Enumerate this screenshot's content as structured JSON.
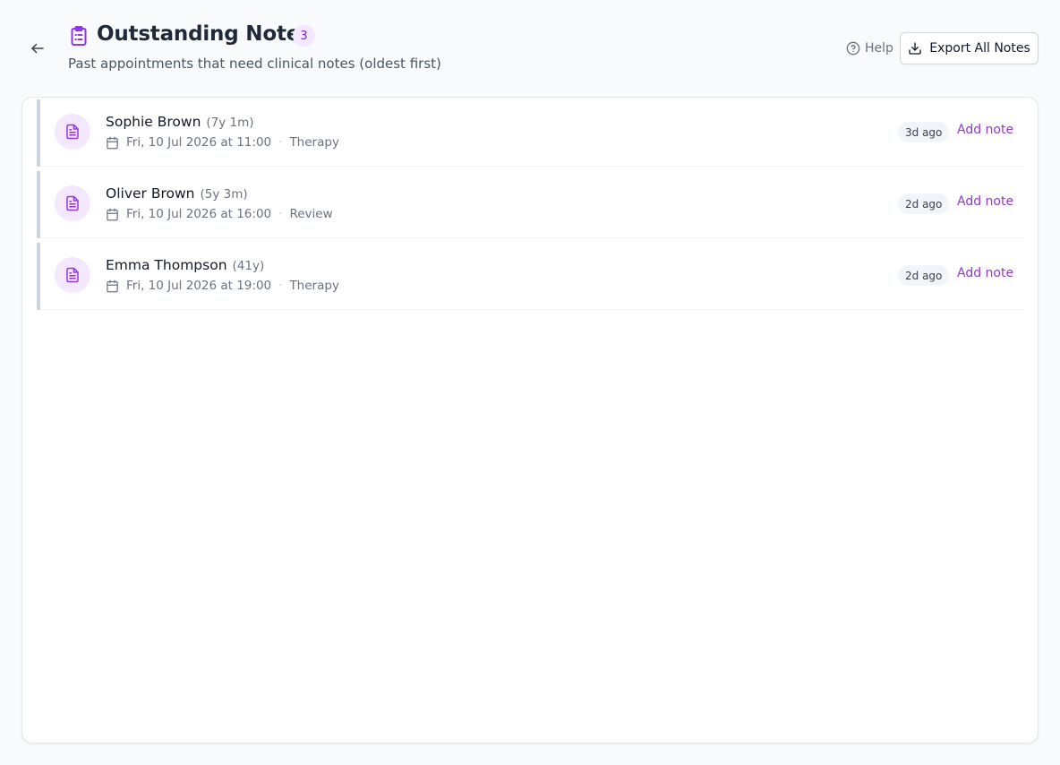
{
  "header": {
    "title": "Outstanding Notes",
    "count": "3",
    "subtitle": "Past appointments that need clinical notes (oldest first)",
    "help_label": "Help",
    "export_label": "Export All Notes"
  },
  "colors": {
    "accent": "#9333ea",
    "accent_soft": "#f3e8ff",
    "row_bar": "#cbd5e1"
  },
  "appointments": [
    {
      "name": "Sophie Brown",
      "age": "(7y 1m)",
      "datetime": "Fri, 10 Jul 2026 at 11:00",
      "type": "Therapy",
      "ago": "3d ago",
      "action": "Add note"
    },
    {
      "name": "Oliver Brown",
      "age": "(5y 3m)",
      "datetime": "Fri, 10 Jul 2026 at 16:00",
      "type": "Review",
      "ago": "2d ago",
      "action": "Add note"
    },
    {
      "name": "Emma Thompson",
      "age": "(41y)",
      "datetime": "Fri, 10 Jul 2026 at 19:00",
      "type": "Therapy",
      "ago": "2d ago",
      "action": "Add note"
    }
  ]
}
